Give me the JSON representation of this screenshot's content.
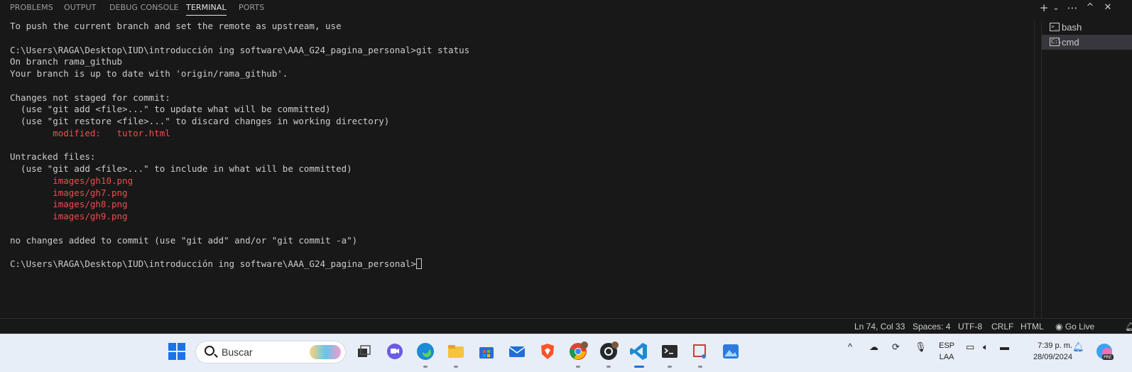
{
  "panel": {
    "tabs": [
      "PROBLEMS",
      "OUTPUT",
      "DEBUG CONSOLE",
      "TERMINAL",
      "PORTS"
    ],
    "active_tab": "TERMINAL",
    "actions": [
      "+",
      "⌄",
      "⋯",
      "^",
      "✕"
    ]
  },
  "terminal": {
    "lines": [
      {
        "text": "To push the current branch and set the remote as upstream, use",
        "color": "default"
      },
      {
        "text": "",
        "color": "default"
      },
      {
        "text": "C:\\Users\\RAGA\\Desktop\\IUD\\introducción ing software\\AAA_G24_pagina_personal>git status",
        "color": "default"
      },
      {
        "text": "On branch rama_github",
        "color": "default"
      },
      {
        "text": "Your branch is up to date with 'origin/rama_github'.",
        "color": "default"
      },
      {
        "text": "",
        "color": "default"
      },
      {
        "text": "Changes not staged for commit:",
        "color": "default"
      },
      {
        "text": "  (use \"git add <file>...\" to update what will be committed)",
        "color": "default"
      },
      {
        "text": "  (use \"git restore <file>...\" to discard changes in working directory)",
        "color": "default"
      },
      {
        "text": "        modified:   tutor.html",
        "color": "red"
      },
      {
        "text": "",
        "color": "default"
      },
      {
        "text": "Untracked files:",
        "color": "default"
      },
      {
        "text": "  (use \"git add <file>...\" to include in what will be committed)",
        "color": "default"
      },
      {
        "text": "        images/gh10.png",
        "color": "red"
      },
      {
        "text": "        images/gh7.png",
        "color": "red"
      },
      {
        "text": "        images/gh8.png",
        "color": "red"
      },
      {
        "text": "        images/gh9.png",
        "color": "red"
      },
      {
        "text": "",
        "color": "default"
      },
      {
        "text": "no changes added to commit (use \"git add\" and/or \"git commit -a\")",
        "color": "default"
      },
      {
        "text": "",
        "color": "default"
      }
    ],
    "prompt": "C:\\Users\\RAGA\\Desktop\\IUD\\introducción ing software\\AAA_G24_pagina_personal>",
    "instances": [
      {
        "label": "bash",
        "icon": "terminal-bash-icon",
        "selected": false
      },
      {
        "label": "cmd",
        "icon": "terminal-cmd-icon",
        "selected": true
      }
    ]
  },
  "statusbar": {
    "position": "Ln 74, Col 33",
    "spaces": "Spaces: 4",
    "encoding": "UTF-8",
    "eol": "CRLF",
    "language": "HTML",
    "go_live": "Go Live"
  },
  "taskbar": {
    "search_placeholder": "Buscar",
    "apps": [
      "start-icon",
      "task-view-icon",
      "chat-icon",
      "edge-icon",
      "file-explorer-icon",
      "store-icon",
      "mail-icon",
      "brave-icon",
      "chrome-icon",
      "github-desktop-icon",
      "vscode-icon",
      "terminal-icon",
      "snipping-icon",
      "photos-icon"
    ],
    "lang": "ESP",
    "lang_sub": "LAA",
    "time": "7:39 p. m.",
    "date": "28/09/2024",
    "colors": {
      "red_text": "#f14c4c",
      "bg": "#181818",
      "taskbar": "#e8eef7"
    }
  }
}
